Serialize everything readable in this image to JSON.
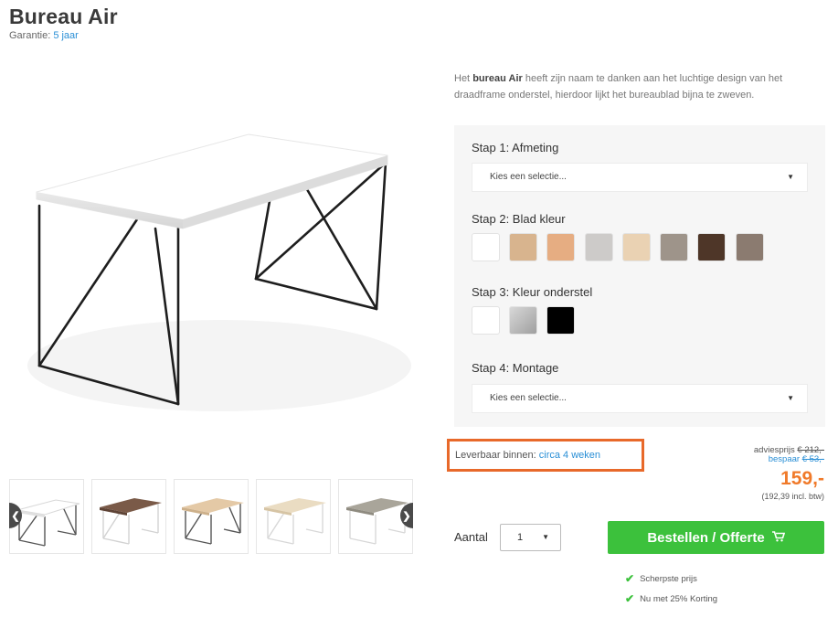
{
  "product": {
    "title": "Bureau Air",
    "garantie_label": "Garantie:",
    "garantie_value": "5 jaar"
  },
  "description": {
    "prefix": "Het ",
    "bold": "bureau Air",
    "rest": " heeft zijn naam te danken aan het luchtige design van het draadframe onderstel, hierdoor lijkt het bureaublad bijna te zweven."
  },
  "steps": {
    "step1_label": "Stap 1: Afmeting",
    "step1_select": "Kies een selectie...",
    "step2_label": "Stap 2: Blad kleur",
    "step3_label": "Stap 3: Kleur onderstel",
    "step4_label": "Stap 4: Montage",
    "step4_select": "Kies een selectie..."
  },
  "colors": {
    "blad": [
      "#ffffff",
      "#d8b48e",
      "#e6ad82",
      "#cdcbc9",
      "#ead2b3",
      "#9e948a",
      "#4e3628",
      "#8b7b70"
    ],
    "onderstel": [
      "#ffffff",
      "#b9b9b9",
      "#000000"
    ],
    "accent_orange": "#e8692a",
    "price_orange": "#f07a2a",
    "link_blue": "#2a8fd6",
    "button_green": "#3cc13c"
  },
  "delivery": {
    "label": "Leverbaar binnen:",
    "value": "circa 4 weken"
  },
  "pricing": {
    "advies_label": "adviesprijs",
    "advies_value": "€ 212,-",
    "bespaar_label": "bespaar",
    "bespaar_value": "€ 53,-",
    "price": "159,-",
    "incl": "(192,39 incl. btw)"
  },
  "order": {
    "aantal_label": "Aantal",
    "quantity": "1",
    "button_label": "Bestellen / Offerte",
    "usps": [
      "Scherpste prijs",
      "Nu met 25% Korting"
    ]
  },
  "thumbnails": [
    {
      "name": "white-top",
      "top": "#ffffff",
      "frame": "#555555"
    },
    {
      "name": "walnut-top",
      "top": "#7a5a48",
      "frame": "#ffffff"
    },
    {
      "name": "oak-top",
      "top": "#e4c9a6",
      "frame": "#555555"
    },
    {
      "name": "light-oak-top",
      "top": "#eadcc2",
      "frame": "#ffffff"
    },
    {
      "name": "grey-top",
      "top": "#a9a59a",
      "frame": "#ffffff"
    }
  ],
  "icons": {
    "prev": "chevron-left-icon",
    "next": "chevron-right-icon",
    "cart": "cart-icon",
    "check": "check-icon",
    "caret": "caret-down-icon"
  }
}
